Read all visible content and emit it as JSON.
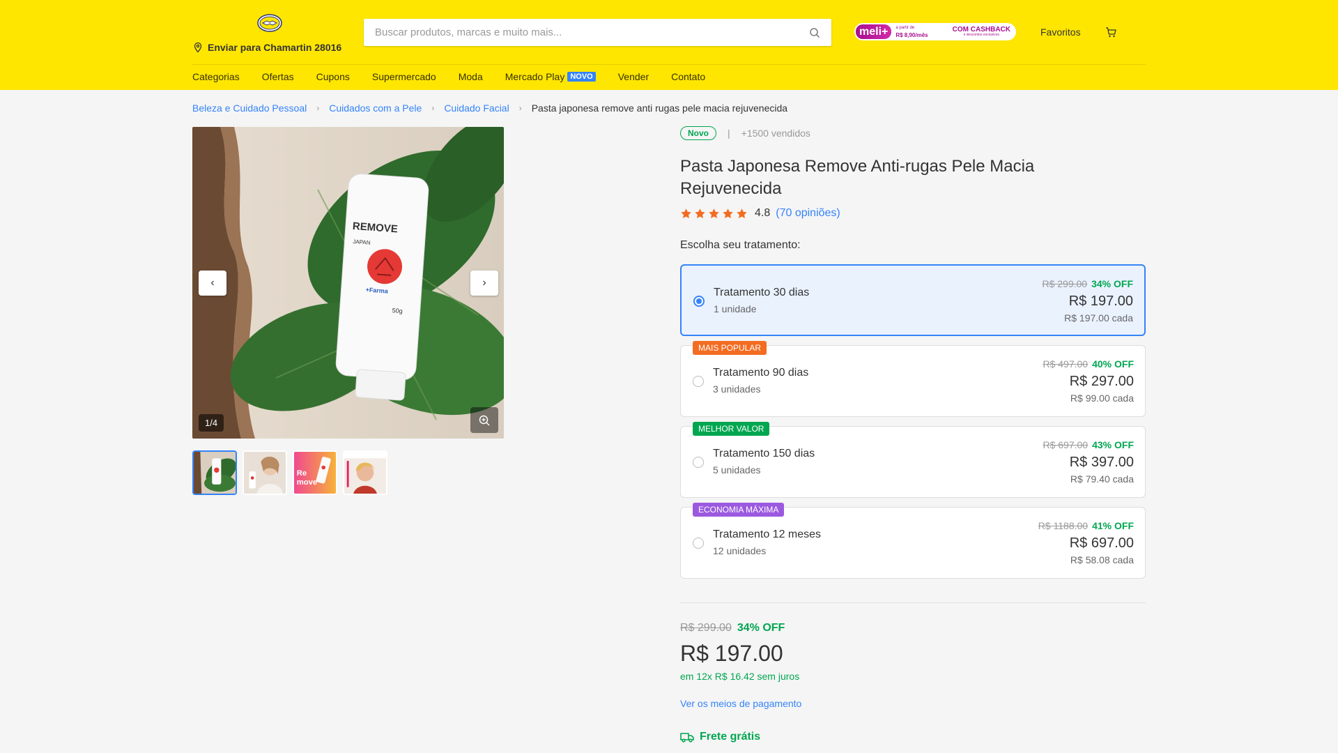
{
  "header": {
    "ship_to": "Enviar para Chamartin 28016",
    "search_placeholder": "Buscar produtos, marcas e muito mais...",
    "meli_banner": {
      "badge": "meli+",
      "small_text": "a partir de",
      "price": "R$ 8,90",
      "price_suffix": "/mês",
      "cashback": "COM CASHBACK",
      "cashback_sub": "e descontos exclusivos"
    },
    "favorites": "Favoritos"
  },
  "nav": {
    "items": [
      "Categorias",
      "Ofertas",
      "Cupons",
      "Supermercado",
      "Moda",
      "Mercado Play",
      "Vender",
      "Contato"
    ],
    "novo_badge": "NOVO"
  },
  "breadcrumb": {
    "items": [
      "Beleza e Cuidado Pessoal",
      "Cuidados com a Pele",
      "Cuidado Facial"
    ],
    "current": "Pasta japonesa remove anti rugas pele macia rejuvenecida"
  },
  "gallery": {
    "counter": "1/4",
    "product_label": "REMOVE",
    "product_sub": "JAPAN",
    "product_brand": "+Farma",
    "product_weight": "50g"
  },
  "product": {
    "condition": "Novo",
    "sold": "+1500 vendidos",
    "title": "Pasta Japonesa Remove Anti-rugas Pele Macia Rejuvenecida",
    "rating": "4.8",
    "reviews": "(70 opiniões)",
    "rating_value": 4.8,
    "choose_label": "Escolha seu tratamento:"
  },
  "options": [
    {
      "name": "Tratamento 30 dias",
      "units": "1 unidade",
      "old": "R$ 299.00",
      "off": "34% OFF",
      "price": "R$ 197.00",
      "each": "R$ 197.00 cada",
      "tag": "",
      "selected": true
    },
    {
      "name": "Tratamento 90 dias",
      "units": "3 unidades",
      "old": "R$ 497.00",
      "off": "40% OFF",
      "price": "R$ 297.00",
      "each": "R$ 99.00 cada",
      "tag": "MAIS POPULAR",
      "tag_color": "#f36c21"
    },
    {
      "name": "Tratamento 150 dias",
      "units": "5 unidades",
      "old": "R$ 697.00",
      "off": "43% OFF",
      "price": "R$ 397.00",
      "each": "R$ 79.40 cada",
      "tag": "MELHOR VALOR",
      "tag_color": "#00a650"
    },
    {
      "name": "Tratamento 12 meses",
      "units": "12 unidades",
      "old": "R$ 1188.00",
      "off": "41% OFF",
      "price": "R$ 697.00",
      "each": "R$ 58.08 cada",
      "tag": "ECONOMIA MÁXIMA",
      "tag_color": "#9b59e0"
    }
  ],
  "summary": {
    "old": "R$ 299.00",
    "off": "34% OFF",
    "price": "R$ 197.00",
    "installments": "em 12x R$ 16.42 sem juros",
    "payment_link": "Ver os meios de pagamento",
    "shipping": "Frete grátis"
  },
  "colors": {
    "brand_yellow": "#ffe600",
    "accent_blue": "#3483fa",
    "success_green": "#00a650",
    "star_orange": "#f36c21"
  }
}
